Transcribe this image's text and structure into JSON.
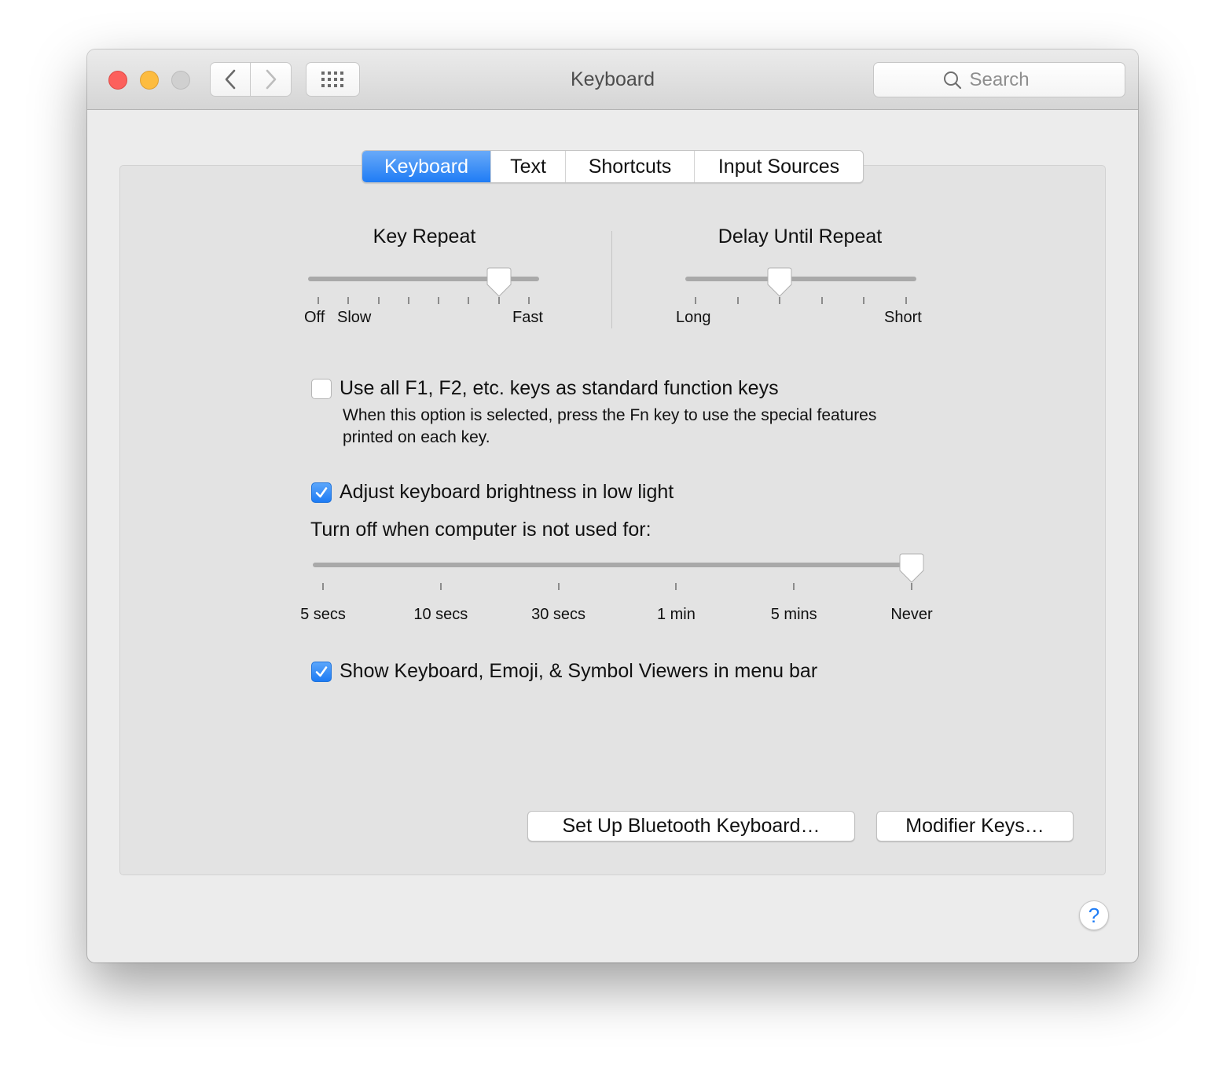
{
  "window": {
    "title": "Keyboard",
    "traffic_lights": {
      "close": "#fc605c",
      "minimize": "#fdbc40",
      "zoom": "#d0d0d0"
    },
    "nav": {
      "back_icon": "chevron-left-icon",
      "forward_icon": "chevron-right-icon",
      "show_all_icon": "grid-icon"
    },
    "search": {
      "placeholder": "Search",
      "value": ""
    }
  },
  "tabs": [
    {
      "label": "Keyboard",
      "active": true
    },
    {
      "label": "Text",
      "active": false
    },
    {
      "label": "Shortcuts",
      "active": false
    },
    {
      "label": "Input Sources",
      "active": false
    }
  ],
  "key_repeat": {
    "title": "Key Repeat",
    "min_label": "Off",
    "slow_label": "Slow",
    "max_label": "Fast",
    "ticks": 8,
    "value_index": 6
  },
  "delay_until_repeat": {
    "title": "Delay Until Repeat",
    "min_label": "Long",
    "max_label": "Short",
    "ticks": 6,
    "value_index": 2
  },
  "options": {
    "function_keys": {
      "label": "Use all F1, F2, etc. keys as standard function keys",
      "checked": false,
      "description": "When this option is selected, press the Fn key to use the special features printed on each key."
    },
    "brightness": {
      "label": "Adjust keyboard brightness in low light",
      "checked": true
    },
    "turn_off_label": "Turn off when computer is not used for:",
    "turn_off_slider": {
      "labels": [
        "5 secs",
        "10 secs",
        "30 secs",
        "1 min",
        "5 mins",
        "Never"
      ],
      "value": "Never",
      "value_index": 5
    },
    "show_viewers": {
      "label": "Show Keyboard, Emoji, & Symbol Viewers in menu bar",
      "checked": true
    }
  },
  "buttons": {
    "bluetooth": "Set Up Bluetooth Keyboard…",
    "modifier": "Modifier Keys…",
    "help": "?"
  },
  "accent_color": "#1f7cf5"
}
